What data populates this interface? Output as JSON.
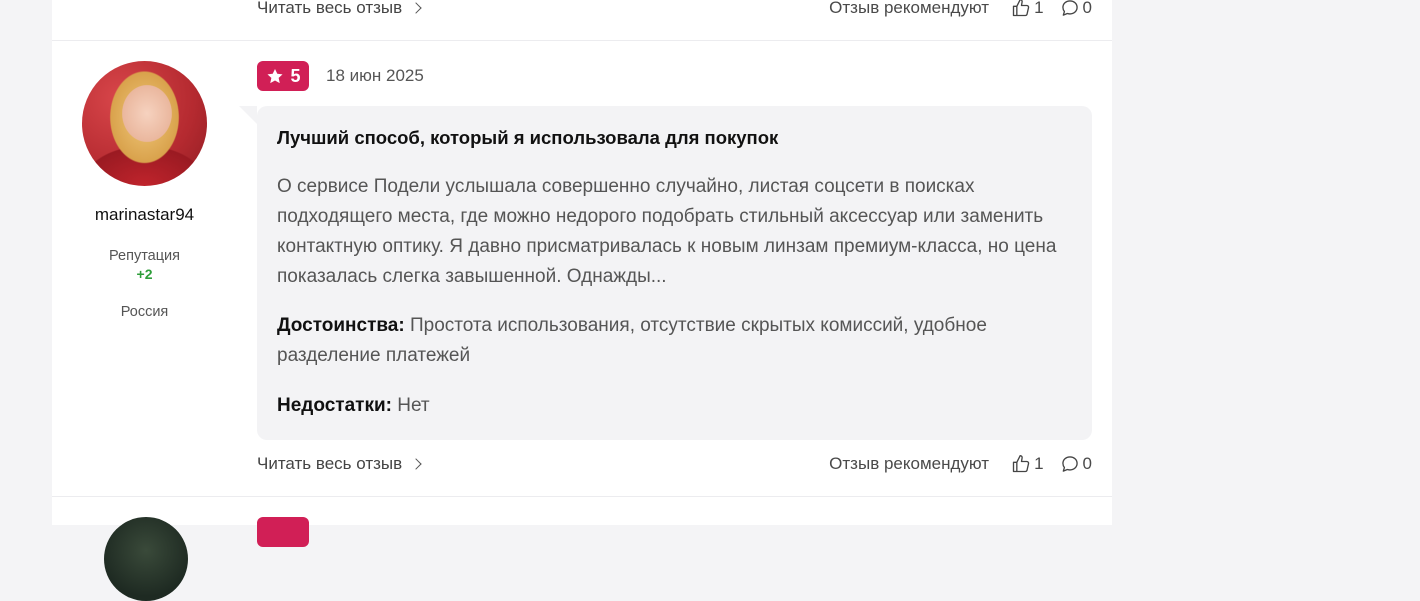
{
  "prev_review": {
    "read_more": "Читать весь отзыв",
    "recommend_label": "Отзыв рекомендуют",
    "likes": "1",
    "comments": "0"
  },
  "review": {
    "author": {
      "username": "marinastar94",
      "reputation_label": "Репутация",
      "reputation_value": "+2",
      "country": "Россия"
    },
    "rating": "5",
    "date": "18 июн 2025",
    "title": "Лучший способ, который я использовала для покупок",
    "text": "О сервисе Подели услышала совершенно случайно, листая соцсети в поисках подходящего места, где можно недорого подобрать стильный аксессуар или заменить контактную оптику. Я давно присматривалась к новым линзам премиум-класса, но цена показалась слегка завышенной. Однажды...",
    "pros_label": "Достоинства:",
    "pros": "Простота использования, отсутствие скрытых комиссий, удобное разделение платежей",
    "cons_label": "Недостатки:",
    "cons": "Нет",
    "read_more": "Читать весь отзыв",
    "recommend_label": "Отзыв рекомендуют",
    "likes": "1",
    "comments": "0"
  },
  "colors": {
    "accent": "#d11f56",
    "reputation_positive": "#2e9e3a",
    "bubble_bg": "#f3f3f5"
  },
  "icons": [
    "star-icon",
    "chevron-right-icon",
    "thumbs-up-icon",
    "comment-icon"
  ]
}
